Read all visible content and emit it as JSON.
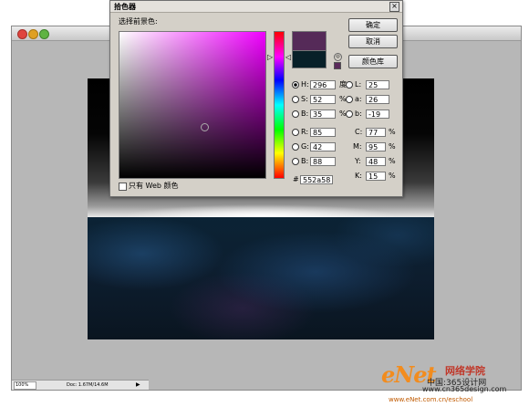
{
  "document": {
    "zoom": "100%",
    "doc_info": "Doc: 1.67M/14.6M",
    "nav_arrow": "▶"
  },
  "picker": {
    "title": "拾色器",
    "close_glyph": "×",
    "foreground_label": "选择前景色:",
    "new_color": "#552a58",
    "current_color": "#082028",
    "gamut_glyph": "◎",
    "buttons": {
      "ok": "确定",
      "cancel": "取消",
      "libraries": "颜色库"
    },
    "hsb": {
      "h_label": "H:",
      "h": "296",
      "h_unit": "度",
      "s_label": "S:",
      "s": "52",
      "s_unit": "%",
      "b_label": "B:",
      "b": "35",
      "b_unit": "%"
    },
    "rgb": {
      "r_label": "R:",
      "r": "85",
      "g_label": "G:",
      "g": "42",
      "b_label": "B:",
      "b": "88"
    },
    "lab": {
      "l_label": "L:",
      "l": "25",
      "a_label": "a:",
      "a": "26",
      "b_label": "b:",
      "b": "-19"
    },
    "cmyk": {
      "c_label": "C:",
      "c": "77",
      "m_label": "M:",
      "m": "95",
      "y_label": "Y:",
      "y": "48",
      "k_label": "K:",
      "k": "15",
      "unit": "%"
    },
    "hex_label": "#",
    "hex": "552a58",
    "web_only_label": "只有 Web 颜色"
  },
  "watermark": {
    "logo": "eNet",
    "brand": "网络学院",
    "site": "中国:365设计网",
    "url": "www.cn365design.com",
    "url2": "www.eNet.com.cn/eschool"
  }
}
